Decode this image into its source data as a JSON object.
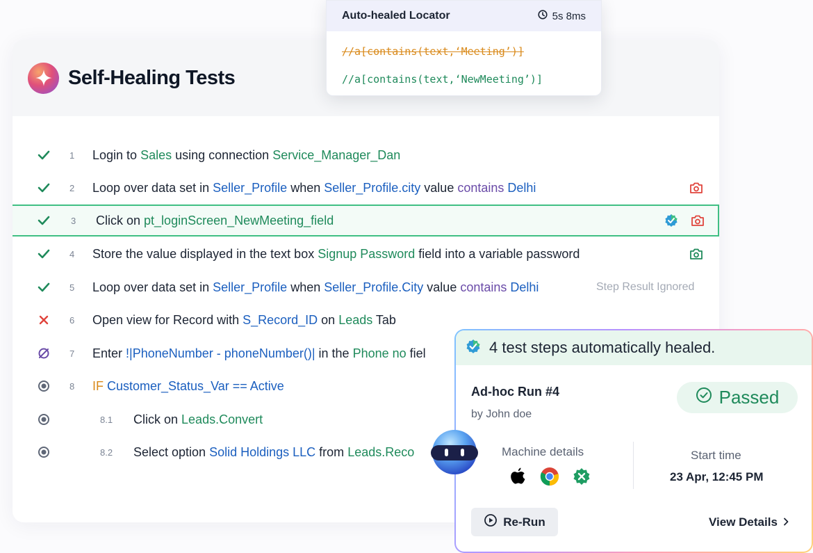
{
  "app": {
    "title": "Self-Healing Tests"
  },
  "locator_popup": {
    "title": "Auto-healed Locator",
    "duration": "5s 8ms",
    "old_locator": "//a[contains(text,‘Meeting’)]",
    "new_locator": "//a[contains(text,‘NewMeeting’)]"
  },
  "steps": [
    {
      "num": "1",
      "status": "passed",
      "parts": [
        "Login to ",
        "Sales",
        " using connection ",
        "Service_Manager_Dan"
      ]
    },
    {
      "num": "2",
      "status": "passed",
      "parts": [
        "Loop over data set in ",
        "Seller_Profile",
        " when ",
        "Seller_Profile.city",
        " value ",
        "contains",
        " ",
        "Delhi"
      ]
    },
    {
      "num": "3",
      "status": "passed",
      "parts": [
        "Click on ",
        "pt_loginScreen_NewMeeting_field"
      ]
    },
    {
      "num": "4",
      "status": "passed",
      "parts": [
        "Store the value displayed in the text box ",
        "Signup Password",
        " field into a variable password"
      ]
    },
    {
      "num": "5",
      "status": "passed",
      "parts": [
        "Loop over data set in ",
        "Seller_Profile",
        " when ",
        "Seller_Profile.City",
        " value ",
        "contains",
        " ",
        "Delhi"
      ],
      "note": "Step Result Ignored"
    },
    {
      "num": "6",
      "status": "failed",
      "parts": [
        "Open view for Record with ",
        "S_Record_ID",
        " on ",
        "Leads",
        " Tab"
      ]
    },
    {
      "num": "7",
      "status": "skipped",
      "parts": [
        "Enter ",
        "!",
        "|PhoneNumber - phoneNumber()|",
        " in the ",
        "Phone no",
        " fiel"
      ]
    },
    {
      "num": "8",
      "status": "pending",
      "parts": [
        "IF",
        " Customer_Status_Var",
        " == ",
        "Active"
      ]
    },
    {
      "num": "8.1",
      "status": "pending",
      "parts": [
        "Click on ",
        "Leads.Convert"
      ]
    },
    {
      "num": "8.2",
      "status": "pending",
      "parts": [
        "Select option ",
        "Solid Holdings LLC",
        " from ",
        "Leads.Reco"
      ]
    }
  ],
  "heal_card": {
    "banner": "4 test steps automatically healed.",
    "run_title": "Ad-hoc Run #4",
    "run_by": "by John doe",
    "status": "Passed",
    "machine_label": "Machine details",
    "machine_icons": [
      "apple-icon",
      "chrome-icon",
      "testsigma-agent-icon"
    ],
    "start_label": "Start time",
    "start_value": "23 Apr, 12:45 PM",
    "rerun_label": "Re-Run",
    "view_details_label": "View Details"
  },
  "colors": {
    "green": "#1f8a5b",
    "blue": "#1b5fbf",
    "purple": "#6a4ba8",
    "orange": "#d98a1b",
    "red": "#e0443c",
    "highlight_border": "#3fbf83"
  }
}
